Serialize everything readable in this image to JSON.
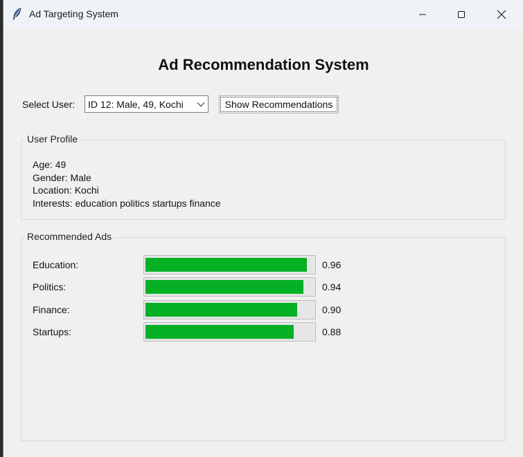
{
  "window": {
    "title": "Ad Targeting System",
    "controls": {
      "minimize_icon": "minimize-icon",
      "maximize_icon": "maximize-icon",
      "close_icon": "close-icon"
    }
  },
  "header": {
    "title": "Ad Recommendation System"
  },
  "user_select": {
    "label": "Select User:",
    "selected": "ID 12: Male, 49, Kochi",
    "button_label": "Show Recommendations"
  },
  "profile": {
    "title": "User Profile",
    "lines": [
      "Age: 49",
      "Gender: Male",
      "Location: Kochi",
      "Interests: education politics startups finance"
    ]
  },
  "ads": {
    "title": "Recommended Ads",
    "bar_color": "#06b025",
    "items": [
      {
        "label": "Education:",
        "score": "0.96",
        "value": 0.96
      },
      {
        "label": "Politics:",
        "score": "0.94",
        "value": 0.94
      },
      {
        "label": "Finance:",
        "score": "0.90",
        "value": 0.9
      },
      {
        "label": "Startups:",
        "score": "0.88",
        "value": 0.88
      }
    ]
  }
}
